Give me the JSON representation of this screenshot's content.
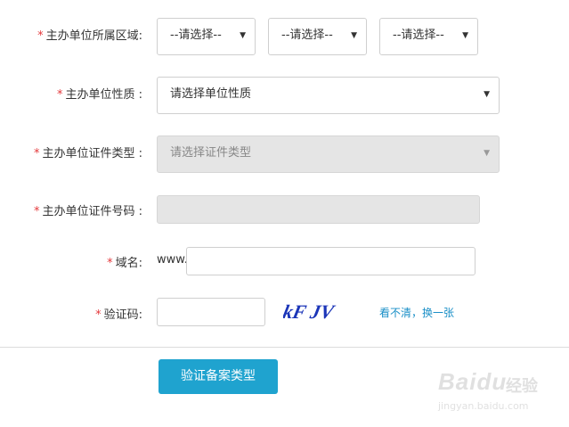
{
  "form": {
    "region": {
      "label": "主办单位所属区域:",
      "selects": [
        "--请选择--",
        "--请选择--",
        "--请选择--"
      ]
    },
    "nature": {
      "label": "主办单位性质 :",
      "value": "请选择单位性质"
    },
    "cert_type": {
      "label": "主办单位证件类型 :",
      "value": "请选择证件类型"
    },
    "cert_number": {
      "label": "主办单位证件号码 :",
      "value": ""
    },
    "domain": {
      "label": "域名:",
      "prefix": "www.",
      "value": ""
    },
    "captcha": {
      "label": "验证码:",
      "value": "",
      "image_text": "kF JV",
      "refresh_label": "看不清，换一张"
    },
    "required_mark": "*"
  },
  "submit_button": {
    "label": "验证备案类型",
    "color": "#1fa3cf"
  },
  "watermark": {
    "brand": "Baidu",
    "cn": "经验",
    "url": "jingyan.baidu.com"
  },
  "colors": {
    "required": "#e4393c",
    "link": "#1a8fc7",
    "disabled_bg": "#e5e5e5"
  }
}
